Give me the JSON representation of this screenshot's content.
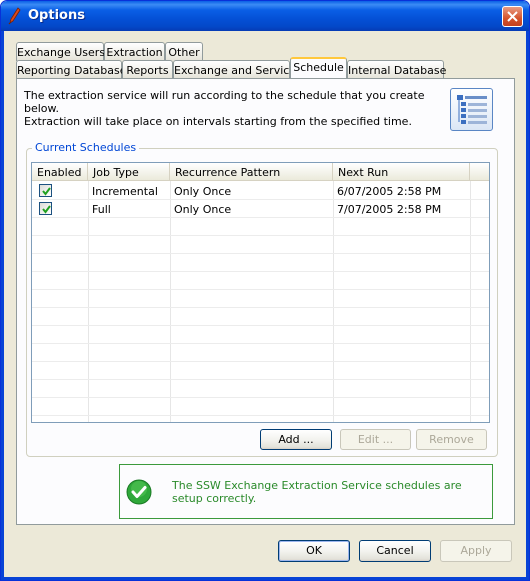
{
  "window": {
    "title": "Options"
  },
  "tabs_row1": [
    "Exchange Users",
    "Extraction",
    "Other"
  ],
  "tabs_row2": [
    "Reporting Database",
    "Reports",
    "Exchange and Service",
    "Schedule",
    "Internal Database"
  ],
  "active_tab": "Schedule",
  "description": {
    "line1": "The extraction service will run according to the schedule that you create below.",
    "line2": "Extraction will take place on intervals starting from the specified time."
  },
  "group": {
    "label": "Current Schedules"
  },
  "table": {
    "columns": [
      "Enabled",
      "Job Type",
      "Recurrence Pattern",
      "Next Run"
    ],
    "rows": [
      {
        "enabled": true,
        "job_type": "Incremental",
        "recurrence": "Only Once",
        "next_run": "6/07/2005 2:58 PM"
      },
      {
        "enabled": true,
        "job_type": "Full",
        "recurrence": "Only Once",
        "next_run": "7/07/2005 2:58 PM"
      }
    ]
  },
  "buttons": {
    "add": "Add ...",
    "edit": "Edit ...",
    "remove": "Remove",
    "ok": "OK",
    "cancel": "Cancel",
    "apply": "Apply"
  },
  "status": {
    "message": "The SSW Exchange Extraction Service schedules are setup correctly."
  },
  "colors": {
    "titlebar": "#0a5fe6",
    "group_label": "#0046d5",
    "status_text": "#2a8a2a",
    "active_tab_accent": "#ffc83c"
  },
  "icons": {
    "app": "app-icon",
    "close": "close-icon",
    "schedule": "schedule-list-icon",
    "status": "check-circle-icon"
  }
}
